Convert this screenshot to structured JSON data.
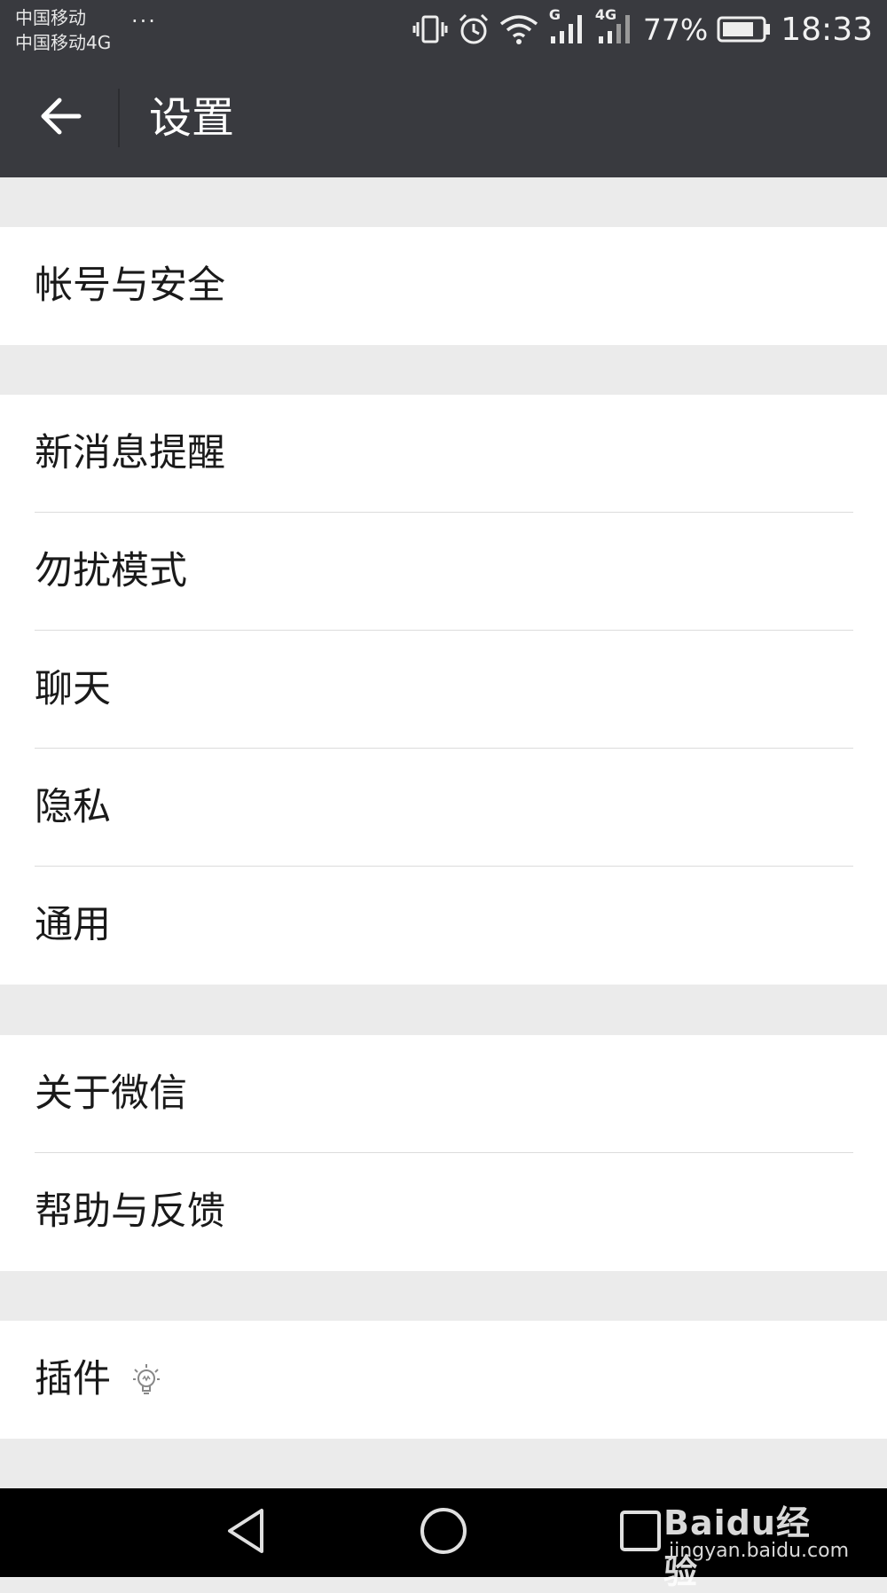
{
  "status_bar": {
    "carrier_1": "中国移动",
    "carrier_2": "中国移动4G",
    "more": "···",
    "network_1": "G",
    "network_2": "4G",
    "battery": "77%",
    "time": "18:33"
  },
  "header": {
    "title": "设置"
  },
  "groups": [
    {
      "items": [
        {
          "label": "帐号与安全"
        }
      ]
    },
    {
      "items": [
        {
          "label": "新消息提醒"
        },
        {
          "label": "勿扰模式"
        },
        {
          "label": "聊天"
        },
        {
          "label": "隐私"
        },
        {
          "label": "通用"
        }
      ]
    },
    {
      "items": [
        {
          "label": "关于微信"
        },
        {
          "label": "帮助与反馈"
        }
      ]
    },
    {
      "items": [
        {
          "label": "插件",
          "icon": "lightbulb-icon"
        }
      ]
    }
  ],
  "nav": {
    "back_icon": "triangle-back-icon",
    "home_icon": "circle-home-icon",
    "recents_icon": "square-recents-icon"
  },
  "watermark": {
    "brand": "Baidu经验",
    "url": "jingyan.baidu.com"
  },
  "colors": {
    "header_bg": "#393a3f",
    "page_bg": "#ebebeb",
    "row_bg": "#ffffff",
    "nav_bg": "#000000"
  }
}
